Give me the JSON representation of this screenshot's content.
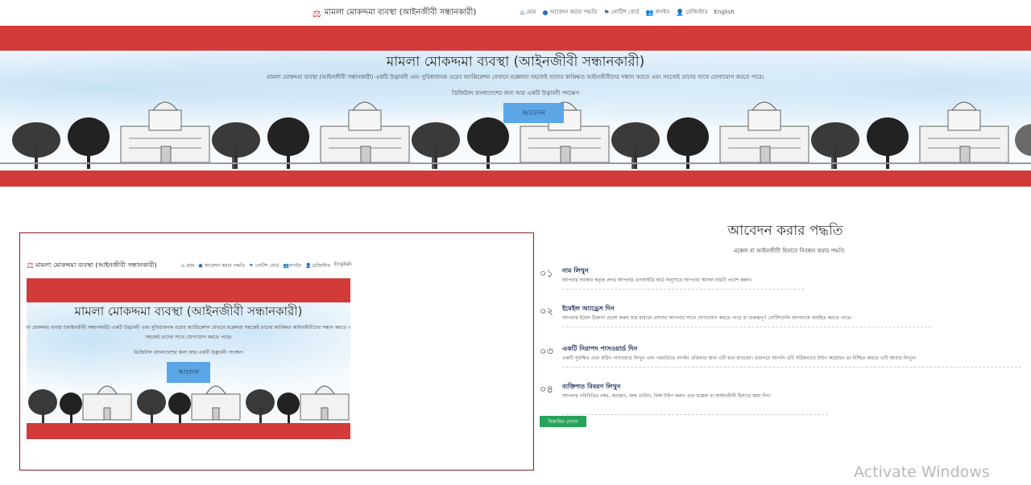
{
  "brand": {
    "logo_icon": "scale-person-icon",
    "name": "মামলা মোকদ্দমা ব্যবস্থা (আইনজীবী সন্ধানকারী)"
  },
  "nav": [
    {
      "icon": "home-icon",
      "label": "হোম"
    },
    {
      "icon": "info-icon",
      "label": "আবেদন করার পদ্ধতি"
    },
    {
      "icon": "flag-icon",
      "label": "নোটিশ বোর্ড"
    },
    {
      "icon": "users-icon",
      "label": "লগইন"
    },
    {
      "icon": "user-plus-icon",
      "label": "রেজিস্টার"
    },
    {
      "icon": "",
      "label": "English"
    }
  ],
  "hero": {
    "title": "মামলা মোকদ্দমা ব্যবস্থা (আইনজীবী সন্ধানকারী)",
    "description": "মামলা মোকদ্দমা ব্যবস্থা (আইনজীবী সন্ধানকারী) একটি উদ্ভাবনী এবং সুবিধাজনক ওয়েব অ্যাপ্লিকেশন যেখানে মক্কেলরা সহজেই তাদের কাঙ্ক্ষিত আইনজীবীদের সন্ধান করতে এবং সহজেই তাদের সাথে যোগাযোগ করতে পারে।",
    "description_part1": "মামলা মোকদ্দমা ব্যবস্থা (আইনজীবী সন্ধানকারী) একটি উদ্ভাবনী এবং সুবিধাজনক ওয়েব অ্যাপ্লিকেশন যেখানে মক্কেলরা সহজেই তাদের কাঙ্ক্ষিত আইনজীবীদের সন্ধান করতে এবং",
    "description_part2": "সহজেই তাদের সাথে যোগাযোগ করতে পারে।",
    "subtitle": "ডিজিটাল বাংলাদেশের জন্য আর একটি উদ্ভাবনী পদক্ষেপ",
    "button": "আবেদন"
  },
  "steps": {
    "title": "আবেদন করার পদ্ধতি",
    "subtitle": "মক্কেল বা আইনজীবী হিসাবে নিবন্ধন করার পদ্ধতি",
    "items": [
      {
        "num": "০১",
        "heading": "নাম লিখুন",
        "text": "আপনার সরকার কর্তৃক প্রদত্ত আপনার এনআইডি কার্ড অনুসারে আপনার আসল নামটি প্রবেশ করুন।"
      },
      {
        "num": "০২",
        "heading": "ইমেইল অ্যাড্রেস দিন",
        "text": "আপনার ইমেল ঠিকানা প্রবেশ করুন যার মাধ্যমে প্রশাসন আপনার সাথে যোগাযোগ করতে পারে বা গুরুত্বপূর্ণ নোটিশগুলি আপনাকে অবহিত করতে পারে।"
      },
      {
        "num": "০৩",
        "heading": "একটি নিরাপদ পাসওয়ার্ড দিন",
        "text": "একটি সুরক্ষিত এবং কঠিন পাসওয়ার্ড লিখুন এবং পরবর্তিতে লগইন প্রক্রিয়ার জন্য এটি মনে রাখবেন। তারপরে আপনি এটি সঠিকভাবে টাইপ করেছেন তা নিশ্চিত করতে এটি আবার লিখুন।"
      },
      {
        "num": "০৪",
        "heading": "ব্যক্তিগত বিবরণ লিখুন",
        "text": "আপনার পরিচিতির নম্বর, অবস্থান, জন্ম তারিখ, লিঙ্গ টাইপ করুন এবং মক্কেল বা আইনজীবী হিসাবে জমা দিন।"
      }
    ],
    "more_button": "বিস্তারিত দেখান"
  },
  "watermark": "Activate Windows",
  "colors": {
    "band": "#d33a3a",
    "button": "#5aa6e6",
    "green": "#27a35a",
    "frame": "#8a1c1c"
  }
}
